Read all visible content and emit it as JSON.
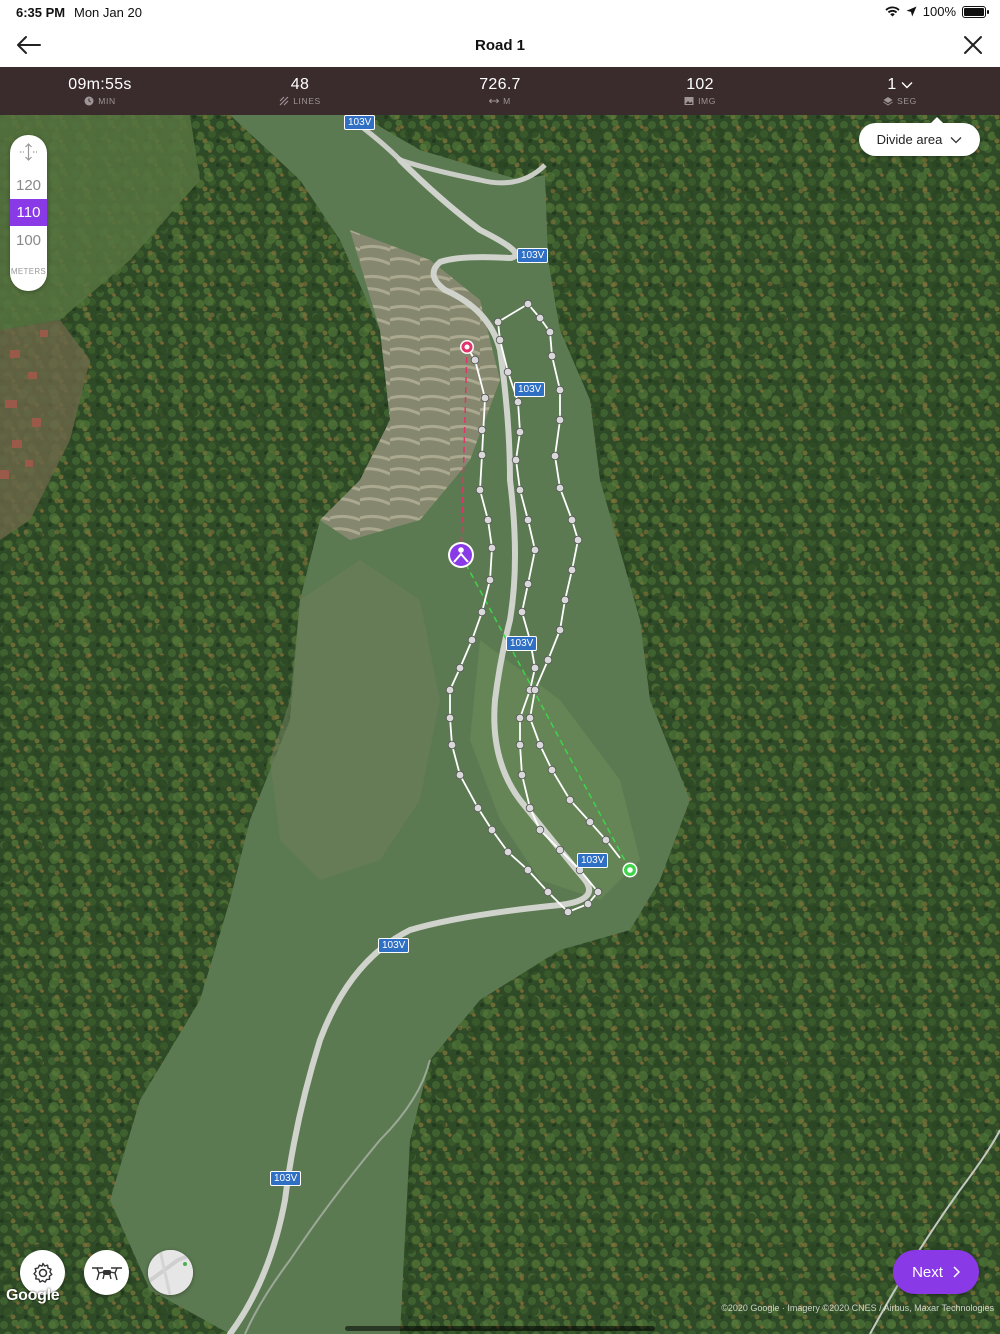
{
  "status_bar": {
    "time": "6:35 PM",
    "date": "Mon Jan 20",
    "battery": "100%"
  },
  "nav": {
    "title": "Road 1",
    "back_icon": "arrow-left-icon",
    "close_icon": "close-icon"
  },
  "stats": [
    {
      "value": "09m:55s",
      "label": "MIN",
      "icon": "clock-icon"
    },
    {
      "value": "48",
      "label": "LINES",
      "icon": "lines-icon"
    },
    {
      "value": "726.7",
      "label": "M",
      "icon": "distance-icon"
    },
    {
      "value": "102",
      "label": "IMG",
      "icon": "image-icon"
    },
    {
      "value": "1",
      "label": "SEG",
      "icon": "layers-icon"
    }
  ],
  "altitude": {
    "options": [
      "120",
      "110",
      "100"
    ],
    "selected": "110",
    "unit": "METERS"
  },
  "divide_area": {
    "label": "Divide area"
  },
  "road_labels": [
    "103V",
    "103V",
    "103V",
    "103V",
    "103V",
    "103V",
    "103V"
  ],
  "map": {
    "logo": "Google",
    "attribution": "©2020 Google · Imagery ©2020 CNES / Airbus, Maxar Technologies"
  },
  "next": {
    "label": "Next"
  },
  "colors": {
    "accent": "#8a39e6",
    "stats_bg": "#3a2b2d",
    "start_marker": "#e0356a",
    "end_marker": "#3ed34a"
  }
}
